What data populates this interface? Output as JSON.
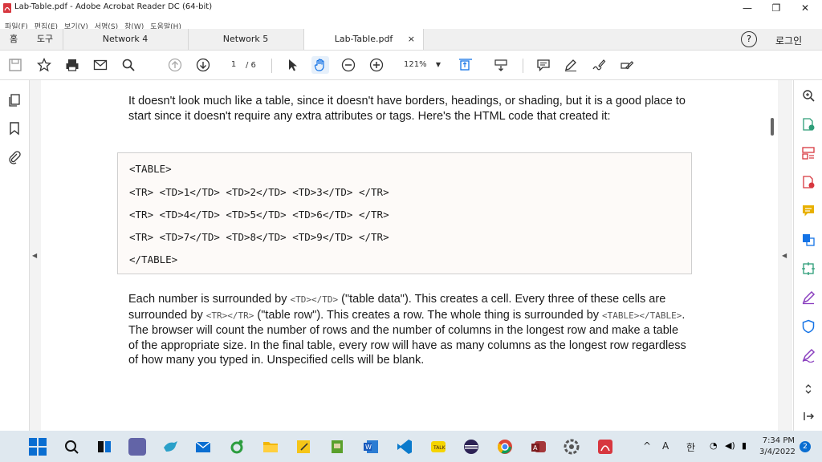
{
  "window": {
    "title": "Lab-Table.pdf - Adobe Acrobat Reader DC (64-bit)",
    "min": "—",
    "max": "❐",
    "close": "✕"
  },
  "menu": [
    "파일(F)",
    "편집(E)",
    "보기(V)",
    "서명(S)",
    "창(W)",
    "도움말(H)"
  ],
  "tabs": {
    "home": "홈",
    "tools": "도구",
    "t1": "Network 4",
    "t2": "Network 5",
    "t3": "Lab-Table.pdf",
    "t3_close": "×",
    "help": "?",
    "login": "로그인"
  },
  "toolbar": {
    "page_current": "1",
    "page_total": "/ 6",
    "zoom": "121%"
  },
  "document": {
    "intro": "It doesn't look much like a table, since it doesn't have borders, headings, or shading, but it is a good place to start since it doesn't require any extra attributes or tags. Here's the HTML code that created it:",
    "code_lines": [
      "<TABLE>",
      "<TR> <TD>1</TD> <TD>2</TD> <TD>3</TD> </TR>",
      "<TR> <TD>4</TD> <TD>5</TD> <TD>6</TD> </TR>",
      "<TR> <TD>7</TD> <TD>8</TD> <TD>9</TD> </TR>",
      "</TABLE>"
    ],
    "p2_a": "Each number is surrounded by ",
    "p2_code1": "<TD></TD>",
    "p2_b": " (\"table data\"). This creates a cell. Every three of these cells are surrounded by ",
    "p2_code2": "<TR></TR>",
    "p2_c": " (\"table row\"). This creates a row. The whole thing is surrounded by ",
    "p2_code3": "<TABLE></TABLE>",
    "p2_d": ". The browser will count the number of rows and the number of columns in the longest row and make a table of the appropriate size. In the final table, every row will have as many columns as the longest row regardless of how many you typed in. Unspecified cells will be blank."
  },
  "tray": {
    "arrow": "^",
    "ime": "A",
    "lang": "한",
    "time": "7:34 PM",
    "date": "3/4/2022",
    "badge": "2"
  },
  "colors": {
    "accent": "#d7373f",
    "taskbar": "#dfe8ef"
  }
}
